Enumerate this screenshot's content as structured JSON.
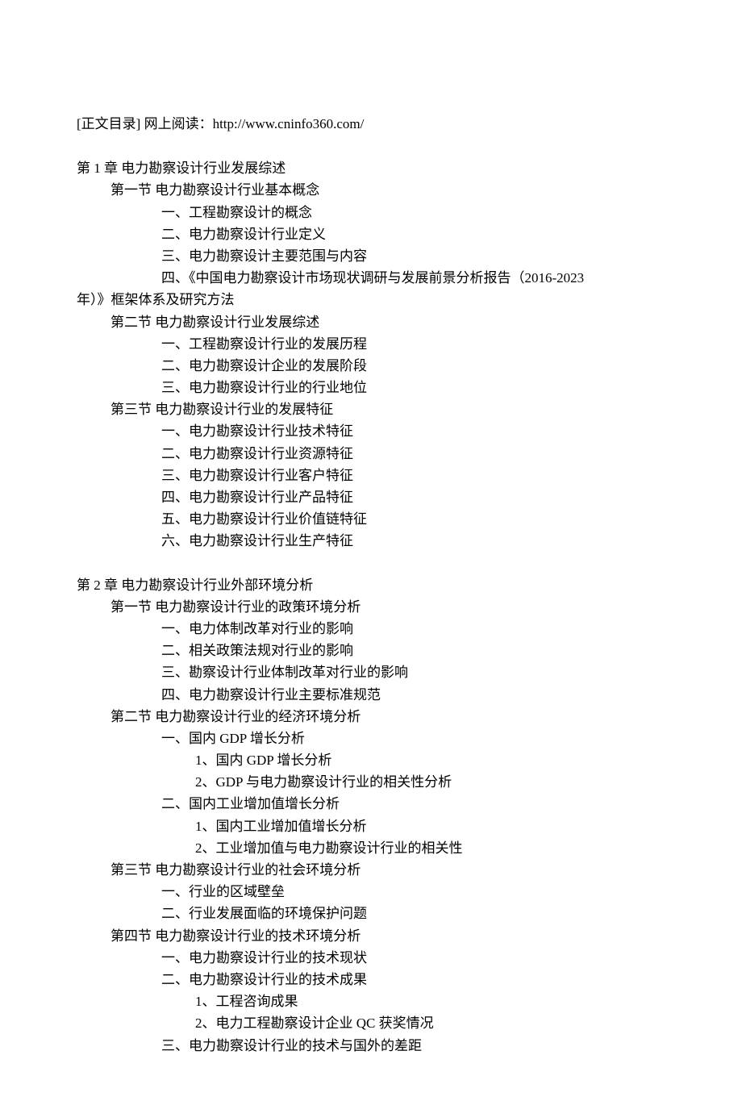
{
  "header": {
    "label": "[正文目录]",
    "read_online_label": "网上阅读：",
    "url": "http://www.cninfo360.com/"
  },
  "chapters": [
    {
      "title": "第 1 章  电力勘察设计行业发展综述",
      "sections": [
        {
          "title": "第一节 电力勘察设计行业基本概念",
          "items": [
            {
              "text": "一、工程勘察设计的概念"
            },
            {
              "text": "二、电力勘察设计行业定义"
            },
            {
              "text": "三、电力勘察设计主要范围与内容"
            },
            {
              "text": "四、《中国电力勘察设计市场现状调研与发展前景分析报告（2016-2023",
              "wrap": "年）》框架体系及研究方法"
            }
          ]
        },
        {
          "title": "第二节 电力勘察设计行业发展综述",
          "items": [
            {
              "text": "一、工程勘察设计行业的发展历程"
            },
            {
              "text": "二、电力勘察设计企业的发展阶段"
            },
            {
              "text": "三、电力勘察设计行业的行业地位"
            }
          ]
        },
        {
          "title": "第三节 电力勘察设计行业的发展特征",
          "items": [
            {
              "text": "一、电力勘察设计行业技术特征"
            },
            {
              "text": "二、电力勘察设计行业资源特征"
            },
            {
              "text": "三、电力勘察设计行业客户特征"
            },
            {
              "text": "四、电力勘察设计行业产品特征"
            },
            {
              "text": "五、电力勘察设计行业价值链特征"
            },
            {
              "text": "六、电力勘察设计行业生产特征"
            }
          ]
        }
      ]
    },
    {
      "title": "第 2 章   电力勘察设计行业外部环境分析",
      "sections": [
        {
          "title": "第一节 电力勘察设计行业的政策环境分析",
          "items": [
            {
              "text": "一、电力体制改革对行业的影响"
            },
            {
              "text": "二、相关政策法规对行业的影响"
            },
            {
              "text": "三、勘察设计行业体制改革对行业的影响"
            },
            {
              "text": "四、电力勘察设计行业主要标准规范"
            }
          ]
        },
        {
          "title": "第二节 电力勘察设计行业的经济环境分析",
          "items": [
            {
              "text": "一、国内 GDP 增长分析",
              "subitems": [
                "1、国内 GDP 增长分析",
                "2、GDP 与电力勘察设计行业的相关性分析"
              ]
            },
            {
              "text": "二、国内工业增加值增长分析",
              "subitems": [
                "1、国内工业增加值增长分析",
                "2、工业增加值与电力勘察设计行业的相关性"
              ]
            }
          ]
        },
        {
          "title": "第三节 电力勘察设计行业的社会环境分析",
          "items": [
            {
              "text": "一、行业的区域壁垒"
            },
            {
              "text": "二、行业发展面临的环境保护问题"
            }
          ]
        },
        {
          "title": "第四节 电力勘察设计行业的技术环境分析",
          "items": [
            {
              "text": "一、电力勘察设计行业的技术现状"
            },
            {
              "text": "二、电力勘察设计行业的技术成果",
              "subitems": [
                "1、工程咨询成果",
                "2、电力工程勘察设计企业 QC 获奖情况"
              ]
            },
            {
              "text": "三、电力勘察设计行业的技术与国外的差距"
            }
          ]
        }
      ]
    }
  ]
}
